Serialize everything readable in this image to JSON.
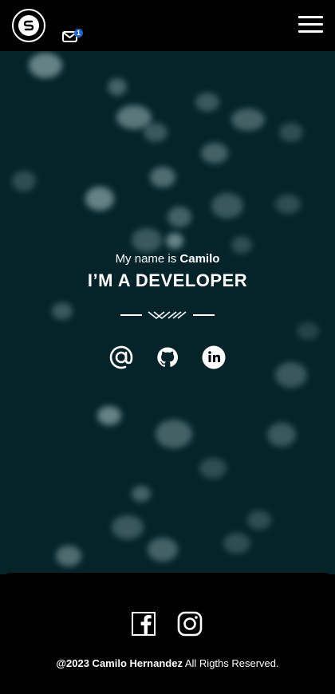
{
  "header": {
    "logo_letter": "S",
    "mail_badge_count": "1",
    "menu_icon": "hamburger-icon"
  },
  "hero": {
    "greeting_prefix": "My name is ",
    "name": "Camilo",
    "headline": "I’M A DEVELOPER",
    "social_icons": [
      "at-icon",
      "github-icon",
      "linkedin-icon"
    ],
    "background_color": "#04242a"
  },
  "footer": {
    "social_icons": [
      "facebook-icon",
      "instagram-icon"
    ],
    "copyright_owner": "@2023 Camilo Hernandez",
    "copyright_suffix": " All Rigths Reserved."
  }
}
